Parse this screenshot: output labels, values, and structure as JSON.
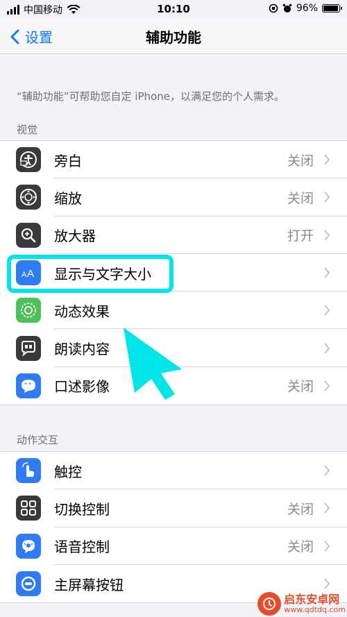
{
  "status": {
    "carrier": "中国移动",
    "time": "10:10",
    "battery_percent": "96%",
    "battery_level": 0.96
  },
  "nav": {
    "back_label": "设置",
    "title": "辅助功能"
  },
  "intro": "“辅助功能”可帮助您自定 iPhone，以满足您的个人需求。",
  "sections": [
    {
      "header": "视觉",
      "items": [
        {
          "label": "旁白",
          "value": "关闭",
          "icon": "voiceover-icon",
          "color": "#3a3a3c"
        },
        {
          "label": "缩放",
          "value": "关闭",
          "icon": "zoom-icon",
          "color": "#3a3a3c"
        },
        {
          "label": "放大器",
          "value": "打开",
          "icon": "magnifier-icon",
          "color": "#3a3a3c"
        },
        {
          "label": "显示与文字大小",
          "value": "",
          "icon": "text-size-icon",
          "color": "#2f7cf6"
        },
        {
          "label": "动态效果",
          "value": "",
          "icon": "motion-icon",
          "color": "#4cc15a"
        },
        {
          "label": "朗读内容",
          "value": "",
          "icon": "spoken-content-icon",
          "color": "#3a3a3c"
        },
        {
          "label": "口述影像",
          "value": "关闭",
          "icon": "audio-description-icon",
          "color": "#2f7cf6"
        }
      ]
    },
    {
      "header": "动作交互",
      "items": [
        {
          "label": "触控",
          "value": "",
          "icon": "touch-icon",
          "color": "#2f7cf6"
        },
        {
          "label": "切换控制",
          "value": "关闭",
          "icon": "switch-control-icon",
          "color": "#3a3a3c"
        },
        {
          "label": "语音控制",
          "value": "关闭",
          "icon": "voice-control-icon",
          "color": "#2f7cf6"
        },
        {
          "label": "主屏幕按钮",
          "value": "",
          "icon": "home-button-icon",
          "color": "#2f7cf6"
        }
      ]
    }
  ],
  "watermark": {
    "title": "启东安卓网",
    "site": "www.qdtdq.com"
  }
}
